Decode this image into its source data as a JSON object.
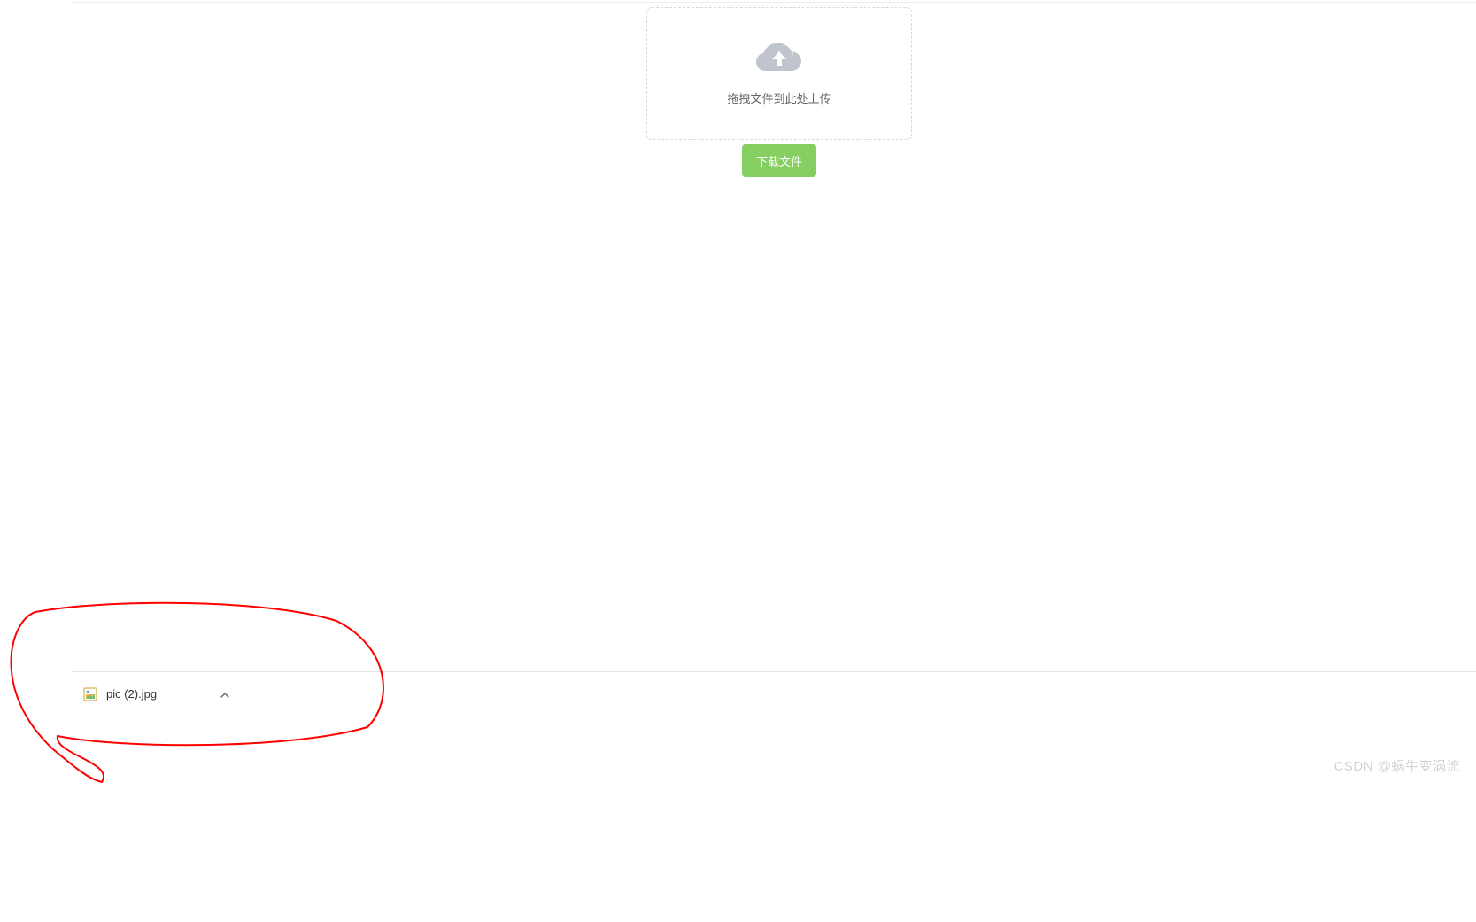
{
  "upload": {
    "hint_text": "拖拽文件到此处上传"
  },
  "buttons": {
    "download_label": "下载文件"
  },
  "downloads_bar": {
    "items": [
      {
        "filename": "pic (2).jpg"
      }
    ]
  },
  "watermark": "CSDN @蜗牛变涡流",
  "colors": {
    "primary_green": "#85ce61",
    "icon_gray": "#c0c4cc",
    "border_dash": "#d9d9d9"
  }
}
